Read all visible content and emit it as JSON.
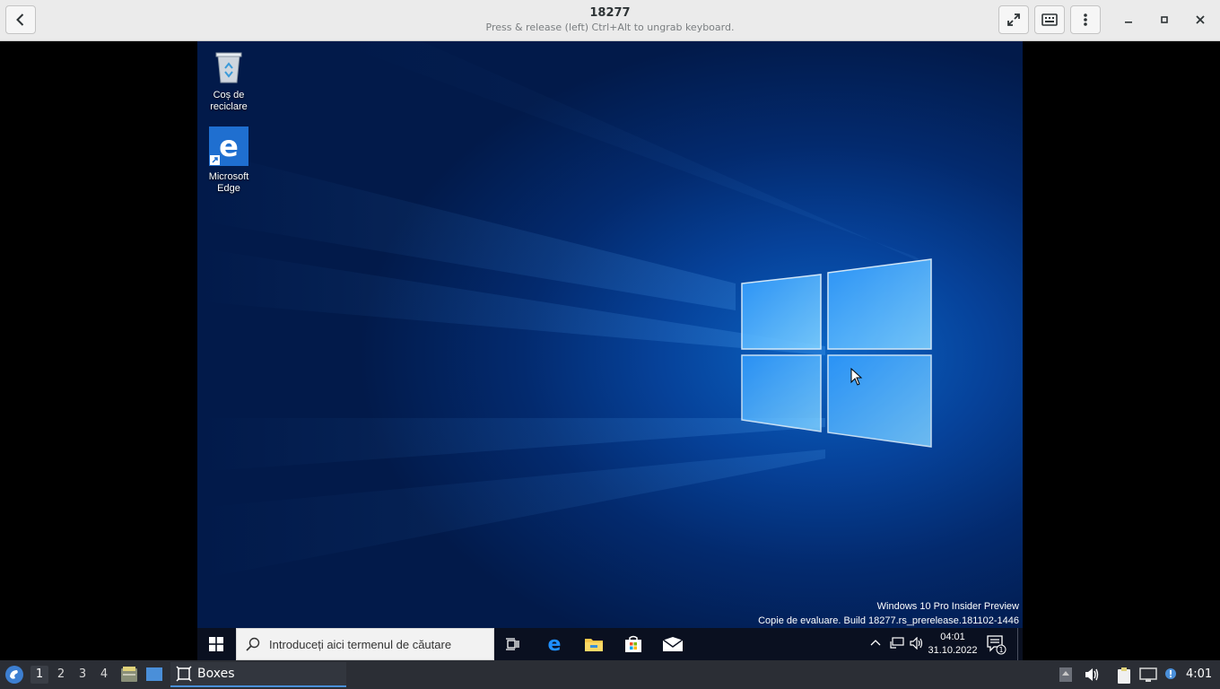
{
  "header": {
    "title": "18277",
    "subtitle": "Press & release (left) Ctrl+Alt to ungrab keyboard."
  },
  "desktop": {
    "icons": [
      {
        "name": "recycle-bin",
        "label_line1": "Coș de",
        "label_line2": "reciclare"
      },
      {
        "name": "microsoft-edge",
        "label_line1": "Microsoft",
        "label_line2": "Edge"
      }
    ],
    "watermark_line1": "Windows 10 Pro Insider Preview",
    "watermark_line2": "Copie de evaluare. Build 18277.rs_prerelease.181102-1446"
  },
  "win_taskbar": {
    "search_placeholder": "Introduceți aici termenul de căutare",
    "clock_time": "04:01",
    "clock_date": "31.10.2022",
    "notification_count": "1"
  },
  "host_panel": {
    "workspaces": [
      "1",
      "2",
      "3",
      "4"
    ],
    "active_workspace": "1",
    "task_label": "Boxes",
    "clock": "4:01",
    "accent": "#4a90d9"
  },
  "colors": {
    "win_blue": "#0078d7",
    "headerbar": "#ebebeb",
    "host_panel": "#2b2e35"
  }
}
